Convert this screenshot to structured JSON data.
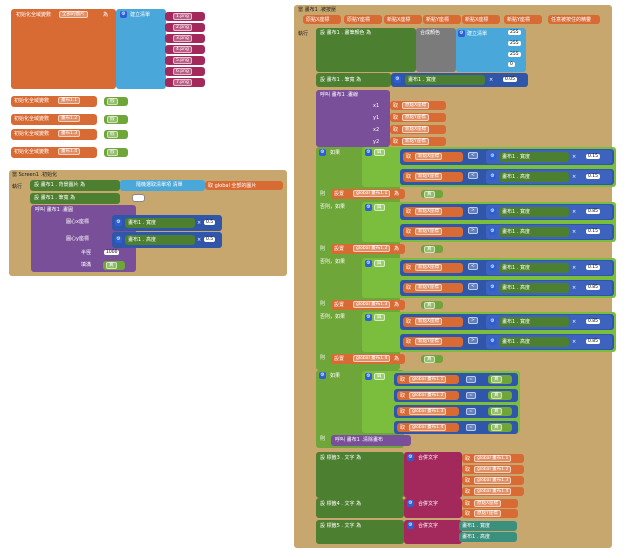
{
  "global_list_block": {
    "keyword": "初始化全域變數",
    "var_name": "全部的圖片",
    "to": "為",
    "create_list": "建立清單",
    "items": [
      "1.png",
      "2.png",
      "3.png",
      "4.png",
      "5.png",
      "6.png",
      "7.png"
    ]
  },
  "global_vars": [
    {
      "name": "畫布1.1",
      "value": "假"
    },
    {
      "name": "畫布1.2",
      "value": "假"
    },
    {
      "name": "畫布1.3",
      "value": "假"
    },
    {
      "name": "畫布1.4",
      "value": "假"
    }
  ],
  "screen_init": {
    "header": "當 Screen1 .初始化",
    "do": "執行",
    "set1_a": "設 畫布1 . 背景圖片 為",
    "set1_b": "隨機選取清單項 清單",
    "set1_c": "取 global 全部的圖片",
    "set2": "設 畫布1 . 筆寬 為",
    "call": "呼叫 畫布1 .畫圓",
    "centerx": "圓心x座標",
    "centery": "圓心y座標",
    "w1": "畫布1",
    "width": "寬度",
    "height": "高度",
    "times": "×",
    "half": "0.5",
    "radius": "半徑",
    "r_val": "1000",
    "fill": "填滿",
    "fill_val": "真"
  },
  "touched": {
    "header": "當 畫布1 .被按壓",
    "params": [
      "原點X座標",
      "原點Y座標",
      "新點X座標",
      "新點Y座標",
      "新點X座標",
      "新點Y座標",
      "任意被按住的精靈"
    ],
    "do": "執行",
    "set_paint": "設 畫布1 . 畫筆顏色 為",
    "make_color": "合成顏色",
    "create_list": "建立清單",
    "color_vals": [
      "255",
      "255",
      "255",
      "0"
    ],
    "set_width": "設 畫布1 . 筆寬 為",
    "canvas_w": "畫布1",
    "width_lbl": "寬度",
    "times": "×",
    "w_val": "0.05",
    "call_line": "呼叫 畫布1 .畫線",
    "x1": "x1",
    "y1": "y1",
    "x2": "x2",
    "y2": "y2",
    "get": "取",
    "line_args": [
      "原點X座標",
      "原點Y座標",
      "新點X座標",
      "新點Y座標"
    ],
    "if": "如果",
    "elseif": "否則，如果",
    "then": "則",
    "and": "與",
    "lt": "<",
    "gt": ">",
    "newx": "新點X座標",
    "newy": "新點Y座標",
    "w": "寬度",
    "h": "高度",
    "conds": [
      {
        "a": "0.15",
        "b": "0.15"
      },
      {
        "a": "0.85",
        "b": "0.15"
      },
      {
        "a": "0.15",
        "b": "0.85"
      },
      {
        "a": "0.85",
        "b": "0.85"
      }
    ],
    "set_prefix": "設置",
    "set_vars": [
      "global 畫布1.1",
      "global 畫布1.2",
      "global 畫布1.3",
      "global 畫布1.4"
    ],
    "to": "為",
    "true": "真",
    "if2": "如果",
    "eq": "=",
    "clear": "呼叫 畫布1 .清除畫布",
    "set_label3": "設 標籤3 . 文字 為",
    "set_label4": "設 標籤4 . 文字 為",
    "set_label5": "設 標籤5 . 文字 為",
    "join": "合併文字",
    "join_vals3": [
      "global 畫布1.1",
      "global 畫布1.2",
      "global 畫布1.3",
      "global 畫布1.4"
    ],
    "join_vals4": [
      "原點X座標",
      "原點Y座標"
    ],
    "join_vals5": [
      "畫布1",
      "畫布1"
    ],
    "join5_props": [
      "寬度",
      "高度"
    ]
  }
}
